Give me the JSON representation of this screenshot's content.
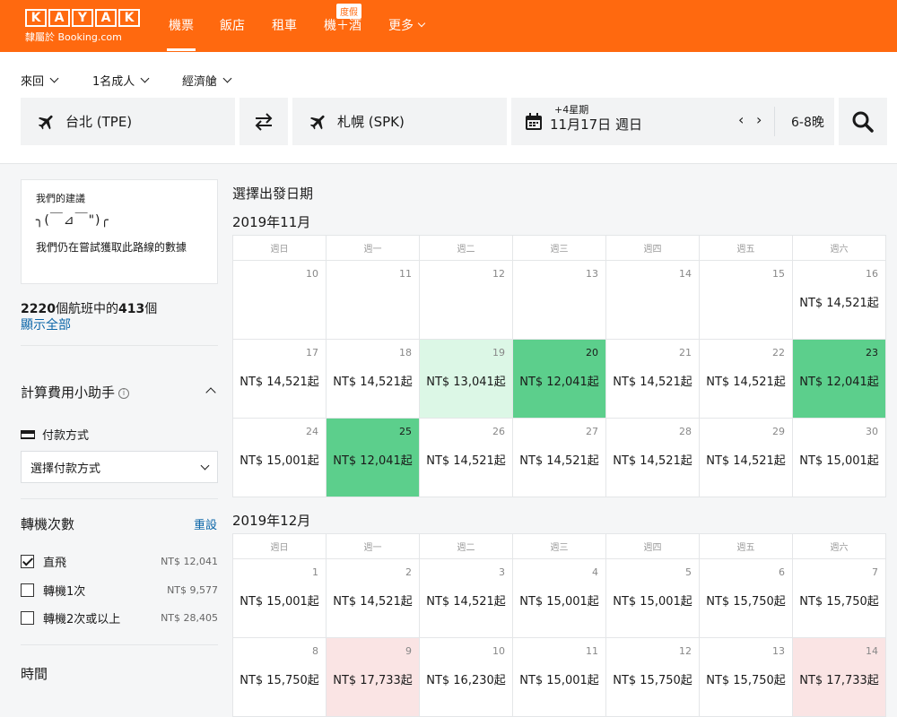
{
  "brand": {
    "letters": [
      "K",
      "A",
      "Y",
      "A",
      "K"
    ],
    "sub": "隸屬於 Booking.com"
  },
  "nav": {
    "flights": "機票",
    "hotels": "飯店",
    "cars": "租車",
    "packages": "機＋酒",
    "packages_badge": "度假",
    "more": "更多"
  },
  "options": {
    "trip_type": "來回",
    "travelers": "1名成人",
    "cabin": "經濟艙"
  },
  "search": {
    "origin": "台北 (TPE)",
    "destination": "札幌 (SPK)",
    "flex_label": "+4星期",
    "date": "11月17日 週日",
    "prev": "‹",
    "next": "›",
    "nights": "6-8晚"
  },
  "sidebar": {
    "suggest_title": "我們的建議",
    "suggest_face": "╮(￣⊿￣\")╭",
    "suggest_text": "我們仍在嘗試獲取此路線的數據",
    "count_total": "2220",
    "count_mid": "個航班中的",
    "count_shown": "413",
    "count_end": "個",
    "show_all": "顯示全部",
    "fee_title": "計算費用小助手",
    "payment_label": "付款方式",
    "payment_select": "選擇付款方式",
    "stops_title": "轉機次數",
    "reset": "重設",
    "stops": [
      {
        "label": "直飛",
        "price": "NT$ 12,041",
        "checked": true
      },
      {
        "label": "轉機1次",
        "price": "NT$ 9,577",
        "checked": false
      },
      {
        "label": "轉機2次或以上",
        "price": "NT$ 28,405",
        "checked": false
      }
    ],
    "time_title": "時間"
  },
  "calendar": {
    "heading": "選擇出發日期",
    "weekdays": [
      "週日",
      "週一",
      "週二",
      "週三",
      "週四",
      "週五",
      "週六"
    ],
    "months": [
      {
        "title": "2019年11月",
        "rows": [
          [
            {
              "d": "10",
              "p": ""
            },
            {
              "d": "11",
              "p": ""
            },
            {
              "d": "12",
              "p": ""
            },
            {
              "d": "13",
              "p": ""
            },
            {
              "d": "14",
              "p": ""
            },
            {
              "d": "15",
              "p": ""
            },
            {
              "d": "16",
              "p": "NT$ 14,521起"
            }
          ],
          [
            {
              "d": "17",
              "p": "NT$ 14,521起"
            },
            {
              "d": "18",
              "p": "NT$ 14,521起"
            },
            {
              "d": "19",
              "p": "NT$ 13,041起",
              "c": "lightgreen"
            },
            {
              "d": "20",
              "p": "NT$ 12,041起",
              "c": "green"
            },
            {
              "d": "21",
              "p": "NT$ 14,521起"
            },
            {
              "d": "22",
              "p": "NT$ 14,521起"
            },
            {
              "d": "23",
              "p": "NT$ 12,041起",
              "c": "green"
            }
          ],
          [
            {
              "d": "24",
              "p": "NT$ 15,001起"
            },
            {
              "d": "25",
              "p": "NT$ 12,041起",
              "c": "green"
            },
            {
              "d": "26",
              "p": "NT$ 14,521起"
            },
            {
              "d": "27",
              "p": "NT$ 14,521起"
            },
            {
              "d": "28",
              "p": "NT$ 14,521起"
            },
            {
              "d": "29",
              "p": "NT$ 14,521起"
            },
            {
              "d": "30",
              "p": "NT$ 15,001起"
            }
          ]
        ]
      },
      {
        "title": "2019年12月",
        "rows": [
          [
            {
              "d": "1",
              "p": "NT$ 15,001起"
            },
            {
              "d": "2",
              "p": "NT$ 14,521起"
            },
            {
              "d": "3",
              "p": "NT$ 14,521起"
            },
            {
              "d": "4",
              "p": "NT$ 15,001起"
            },
            {
              "d": "5",
              "p": "NT$ 15,001起"
            },
            {
              "d": "6",
              "p": "NT$ 15,750起"
            },
            {
              "d": "7",
              "p": "NT$ 15,750起"
            }
          ],
          [
            {
              "d": "8",
              "p": "NT$ 15,750起"
            },
            {
              "d": "9",
              "p": "NT$ 17,733起",
              "c": "pink"
            },
            {
              "d": "10",
              "p": "NT$ 16,230起"
            },
            {
              "d": "11",
              "p": "NT$ 15,001起"
            },
            {
              "d": "12",
              "p": "NT$ 15,750起"
            },
            {
              "d": "13",
              "p": "NT$ 15,750起"
            },
            {
              "d": "14",
              "p": "NT$ 17,733起",
              "c": "pink"
            }
          ]
        ]
      }
    ]
  },
  "colors": {
    "brand": "#ff690f",
    "cheapest": "#5ccf8c",
    "cheap": "#dcf7e6",
    "expensive": "#fae4e4",
    "link": "#0c66a8"
  }
}
